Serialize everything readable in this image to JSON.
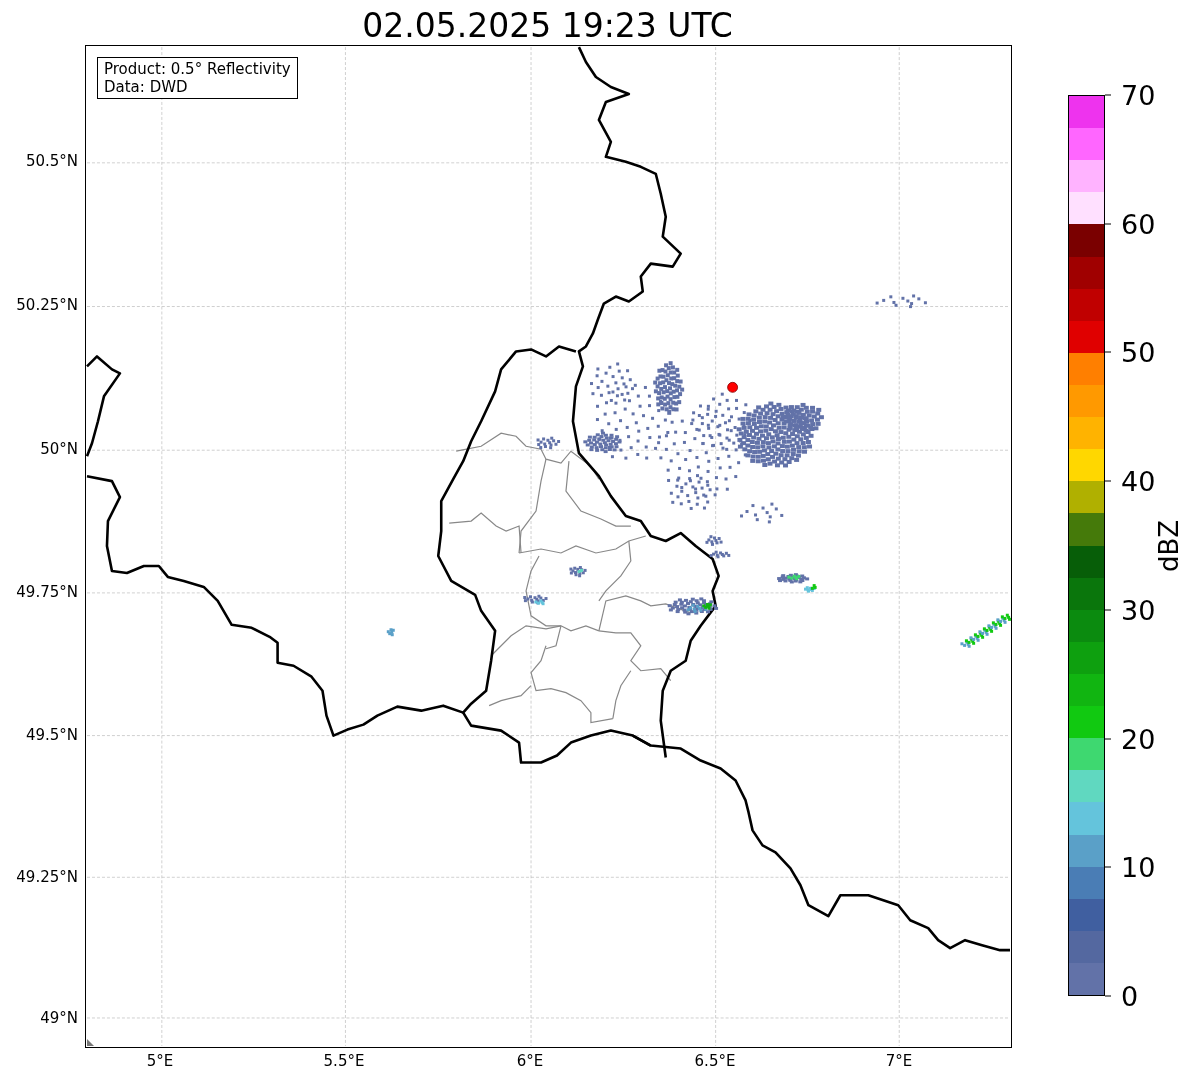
{
  "title": "02.05.2025 19:23 UTC",
  "legend": {
    "lines": [
      "Product: 0.5° Reflectivity",
      "Data: DWD"
    ]
  },
  "map": {
    "yticks": [
      "50.5°N",
      "50.25°N",
      "50°N",
      "49.75°N",
      "49.5°N",
      "49.25°N",
      "49°N"
    ],
    "xticks": [
      "5°E",
      "5.5°E",
      "6°E",
      "6.5°E",
      "7°E"
    ]
  },
  "colorbar": {
    "label": "dBZ",
    "ticks": [
      "70",
      "60",
      "50",
      "40",
      "30",
      "20",
      "10",
      "0"
    ],
    "segments": [
      {
        "color": "#ee33ee"
      },
      {
        "color": "#ff66ff"
      },
      {
        "color": "#ffb3ff"
      },
      {
        "color": "#ffe0ff"
      },
      {
        "color": "#7a0000"
      },
      {
        "color": "#a00000"
      },
      {
        "color": "#c00000"
      },
      {
        "color": "#e00000"
      },
      {
        "color": "#ff7f00"
      },
      {
        "color": "#ff9900"
      },
      {
        "color": "#ffb300"
      },
      {
        "color": "#ffd700"
      },
      {
        "color": "#b0b000"
      },
      {
        "color": "#457a0a"
      },
      {
        "color": "#075e08"
      },
      {
        "color": "#0a760c"
      },
      {
        "color": "#0b8b0f"
      },
      {
        "color": "#0ea00f"
      },
      {
        "color": "#11b511"
      },
      {
        "color": "#11c911"
      },
      {
        "color": "#3ed870"
      },
      {
        "color": "#60d8c0"
      },
      {
        "color": "#64c4dc"
      },
      {
        "color": "#5aa0c8"
      },
      {
        "color": "#4a7db5"
      },
      {
        "color": "#405fa0"
      },
      {
        "color": "#5468a0"
      },
      {
        "color": "#6272a8"
      }
    ]
  }
}
